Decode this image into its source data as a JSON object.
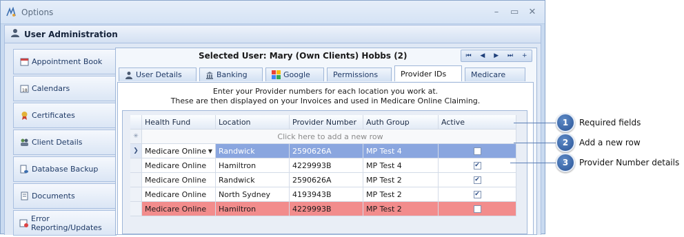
{
  "window": {
    "title": "Options",
    "controls": [
      "–",
      "▭",
      "✕"
    ]
  },
  "section": {
    "title": "User Administration"
  },
  "sidebar": {
    "items": [
      {
        "label": "Appointment Book",
        "icon": "calendar-book-icon"
      },
      {
        "label": "Calendars",
        "icon": "calendar-icon"
      },
      {
        "label": "Certificates",
        "icon": "certificate-ribbon-icon"
      },
      {
        "label": "Client Details",
        "icon": "people-icon"
      },
      {
        "label": "Database Backup",
        "icon": "database-backup-icon"
      },
      {
        "label": "Documents",
        "icon": "document-icon"
      },
      {
        "label": "Error Reporting/Updates",
        "icon": "error-report-icon"
      }
    ]
  },
  "main": {
    "selected_user": "Selected User: Mary (Own Clients) Hobbs (2)",
    "nav_buttons": [
      "⏮",
      "◀",
      "▶",
      "⏭",
      "+"
    ],
    "tabs": [
      {
        "label": "User Details",
        "icon": "user-icon",
        "active": false
      },
      {
        "label": "Banking",
        "icon": "bank-icon",
        "active": false
      },
      {
        "label": "Google",
        "icon": "google-icon",
        "active": false
      },
      {
        "label": "Permissions",
        "icon": "",
        "active": false
      },
      {
        "label": "Provider IDs",
        "icon": "",
        "active": true
      },
      {
        "label": "Medicare",
        "icon": "",
        "active": false
      }
    ],
    "intro_line1": "Enter your Provider numbers for each location you work at.",
    "intro_line2": "These are then displayed on your Invoices and used in Medicare Online Claiming."
  },
  "grid": {
    "columns": [
      "Health Fund",
      "Location",
      "Provider Number",
      "Auth Group",
      "Active"
    ],
    "new_row_text": "Click here to add a new row",
    "rows": [
      {
        "health_fund": "Medicare Online",
        "location": "Randwick",
        "provider_number": "2590626A",
        "auth_group": "MP Test 4",
        "active": false,
        "state": "selected"
      },
      {
        "health_fund": "Medicare Online",
        "location": "Hamiltron",
        "provider_number": "4229993B",
        "auth_group": "MP Test 4",
        "active": true,
        "state": "normal"
      },
      {
        "health_fund": "Medicare Online",
        "location": "Randwick",
        "provider_number": "2590626A",
        "auth_group": "MP Test 2",
        "active": true,
        "state": "normal"
      },
      {
        "health_fund": "Medicare Online",
        "location": "North Sydney",
        "provider_number": "4193943B",
        "auth_group": "MP Test 2",
        "active": true,
        "state": "normal"
      },
      {
        "health_fund": "Medicare Online",
        "location": "Hamiltron",
        "provider_number": "4229993B",
        "auth_group": "MP Test 2",
        "active": false,
        "state": "error"
      }
    ]
  },
  "callouts": [
    {
      "number": "1",
      "label": "Required fields"
    },
    {
      "number": "2",
      "label": "Add a new row"
    },
    {
      "number": "3",
      "label": "Provider Number details"
    }
  ],
  "colors": {
    "selected_row": "#8aa6df",
    "error_row": "#f28c8c",
    "badge": "#2a5597"
  }
}
